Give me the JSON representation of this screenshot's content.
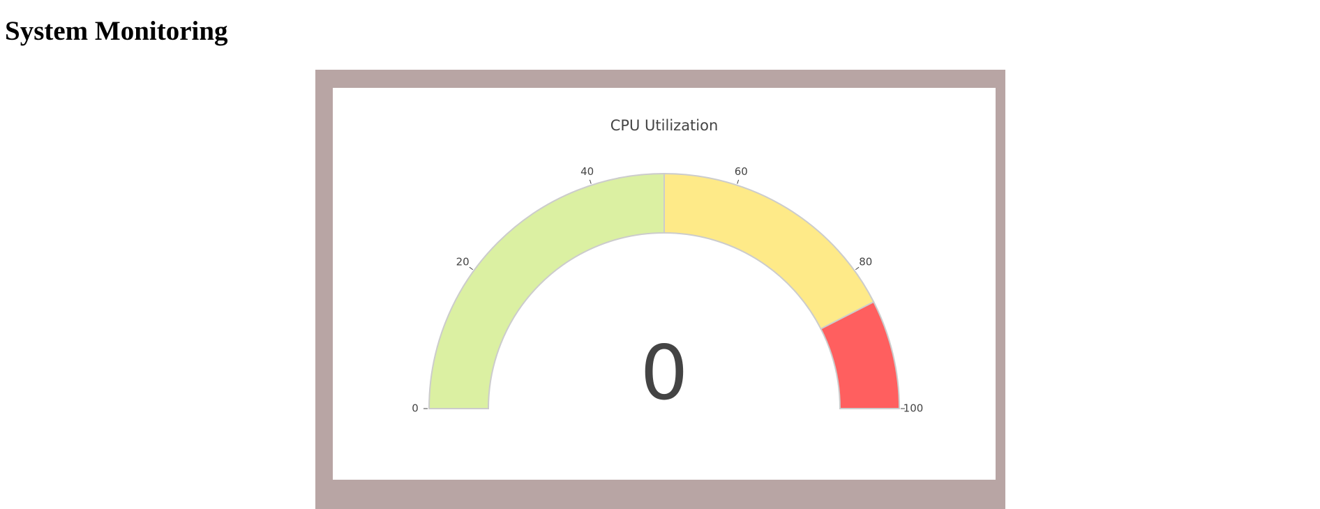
{
  "page": {
    "title": "System Monitoring"
  },
  "panel": {
    "frame_color": "#b8a5a4"
  },
  "chart_data": {
    "type": "gauge",
    "title": "CPU Utilization",
    "value": 0,
    "value_label": "0",
    "range": [
      0,
      100
    ],
    "ticks": [
      0,
      20,
      40,
      60,
      80,
      100
    ],
    "tick_labels": [
      "0",
      "20",
      "40",
      "60",
      "80",
      "100"
    ],
    "steps": [
      {
        "range": [
          0,
          50
        ],
        "color": "#dbf0a2"
      },
      {
        "range": [
          50,
          85
        ],
        "color": "#feea88"
      },
      {
        "range": [
          85,
          100
        ],
        "color": "#ff5f5f"
      }
    ],
    "border_color": "#cccccc"
  }
}
